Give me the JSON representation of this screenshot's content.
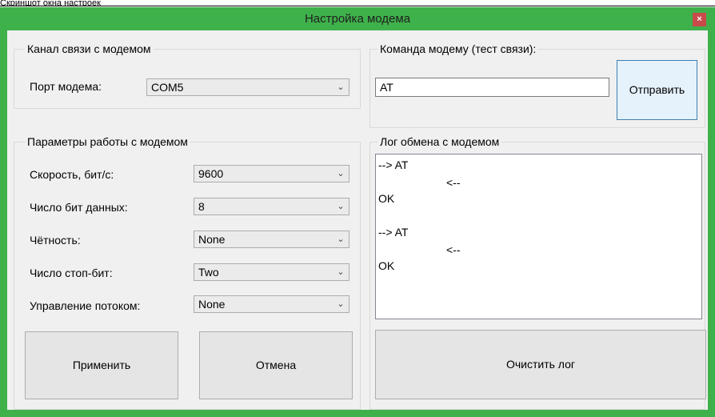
{
  "top_fragment": "Скриншот окна настроек",
  "window": {
    "title": "Настройка модема",
    "close_glyph": "×"
  },
  "channel": {
    "legend": "Канал связи с модемом",
    "port_label": "Порт модема:",
    "port_value": "COM5"
  },
  "params": {
    "legend": "Параметры работы с модемом",
    "speed_label": "Скорость, бит/с:",
    "speed_value": "9600",
    "databits_label": "Число бит данных:",
    "databits_value": "8",
    "parity_label": "Чётность:",
    "parity_value": "None",
    "stopbits_label": "Число стоп-бит:",
    "stopbits_value": "Two",
    "flow_label": "Управление потоком:",
    "flow_value": "None"
  },
  "command": {
    "legend": "Команда модему (тест связи):",
    "value": "AT",
    "send_label": "Отправить"
  },
  "log": {
    "legend": "Лог обмена с модемом",
    "lines": [
      "--> AT",
      "<--",
      "OK",
      "--> AT",
      "<--",
      "OK"
    ],
    "clear_label": "Очистить лог"
  },
  "buttons": {
    "apply_label": "Применить",
    "cancel_label": "Отмена"
  },
  "icons": {
    "dropdown": "chevron-down-icon",
    "close": "close-icon"
  },
  "colors": {
    "titlebar": "#3fb14b",
    "close_button": "#c94a4a",
    "focus_border": "#3c7fb1"
  }
}
